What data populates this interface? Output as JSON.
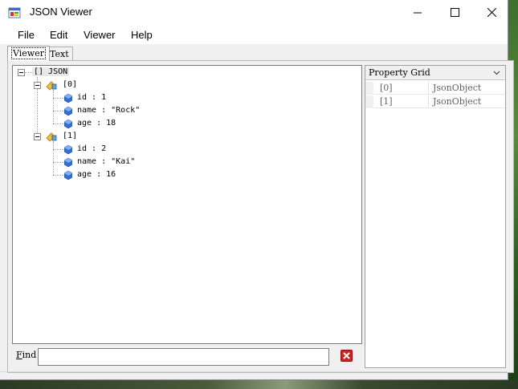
{
  "window": {
    "title": "JSON Viewer"
  },
  "menu": {
    "items": [
      "File",
      "Edit",
      "Viewer",
      "Help"
    ]
  },
  "tabs": [
    {
      "label": "Viewer",
      "active": true
    },
    {
      "label": "Text",
      "active": false
    }
  ],
  "tree": {
    "root": "[] JSON",
    "nodes": [
      {
        "label": "[0]",
        "children": [
          "id : 1",
          "name : \"Rock\"",
          "age : 18"
        ]
      },
      {
        "label": "[1]",
        "children": [
          "id : 2",
          "name : \"Kai\"",
          "age : 16"
        ]
      }
    ]
  },
  "find": {
    "label_prefix": "F",
    "label_rest": "ind",
    "value": ""
  },
  "property_grid": {
    "title": "Property Grid",
    "rows": [
      {
        "key": "[0]",
        "value": "JsonObject"
      },
      {
        "key": "[1]",
        "value": "JsonObject"
      }
    ]
  },
  "colors": {
    "accent": "#1e6fd0",
    "clear_button": "#d42020"
  }
}
